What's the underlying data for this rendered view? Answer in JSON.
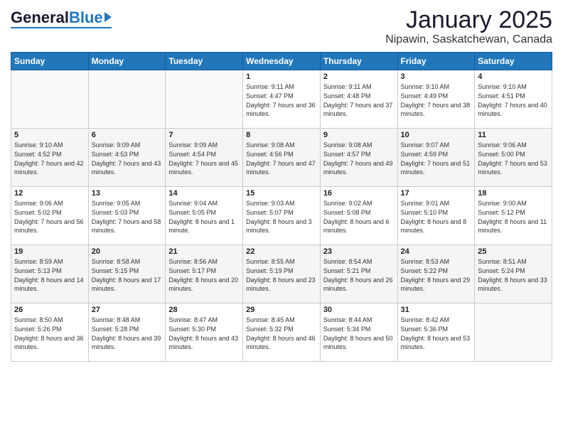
{
  "logo": {
    "general": "General",
    "blue": "Blue"
  },
  "header": {
    "month": "January 2025",
    "location": "Nipawin, Saskatchewan, Canada"
  },
  "weekdays": [
    "Sunday",
    "Monday",
    "Tuesday",
    "Wednesday",
    "Thursday",
    "Friday",
    "Saturday"
  ],
  "weeks": [
    [
      {
        "day": "",
        "info": ""
      },
      {
        "day": "",
        "info": ""
      },
      {
        "day": "",
        "info": ""
      },
      {
        "day": "1",
        "info": "Sunrise: 9:11 AM\nSunset: 4:47 PM\nDaylight: 7 hours and 36 minutes."
      },
      {
        "day": "2",
        "info": "Sunrise: 9:11 AM\nSunset: 4:48 PM\nDaylight: 7 hours and 37 minutes."
      },
      {
        "day": "3",
        "info": "Sunrise: 9:10 AM\nSunset: 4:49 PM\nDaylight: 7 hours and 38 minutes."
      },
      {
        "day": "4",
        "info": "Sunrise: 9:10 AM\nSunset: 4:51 PM\nDaylight: 7 hours and 40 minutes."
      }
    ],
    [
      {
        "day": "5",
        "info": "Sunrise: 9:10 AM\nSunset: 4:52 PM\nDaylight: 7 hours and 42 minutes."
      },
      {
        "day": "6",
        "info": "Sunrise: 9:09 AM\nSunset: 4:53 PM\nDaylight: 7 hours and 43 minutes."
      },
      {
        "day": "7",
        "info": "Sunrise: 9:09 AM\nSunset: 4:54 PM\nDaylight: 7 hours and 45 minutes."
      },
      {
        "day": "8",
        "info": "Sunrise: 9:08 AM\nSunset: 4:56 PM\nDaylight: 7 hours and 47 minutes."
      },
      {
        "day": "9",
        "info": "Sunrise: 9:08 AM\nSunset: 4:57 PM\nDaylight: 7 hours and 49 minutes."
      },
      {
        "day": "10",
        "info": "Sunrise: 9:07 AM\nSunset: 4:59 PM\nDaylight: 7 hours and 51 minutes."
      },
      {
        "day": "11",
        "info": "Sunrise: 9:06 AM\nSunset: 5:00 PM\nDaylight: 7 hours and 53 minutes."
      }
    ],
    [
      {
        "day": "12",
        "info": "Sunrise: 9:06 AM\nSunset: 5:02 PM\nDaylight: 7 hours and 56 minutes."
      },
      {
        "day": "13",
        "info": "Sunrise: 9:05 AM\nSunset: 5:03 PM\nDaylight: 7 hours and 58 minutes."
      },
      {
        "day": "14",
        "info": "Sunrise: 9:04 AM\nSunset: 5:05 PM\nDaylight: 8 hours and 1 minute."
      },
      {
        "day": "15",
        "info": "Sunrise: 9:03 AM\nSunset: 5:07 PM\nDaylight: 8 hours and 3 minutes."
      },
      {
        "day": "16",
        "info": "Sunrise: 9:02 AM\nSunset: 5:08 PM\nDaylight: 8 hours and 6 minutes."
      },
      {
        "day": "17",
        "info": "Sunrise: 9:01 AM\nSunset: 5:10 PM\nDaylight: 8 hours and 8 minutes."
      },
      {
        "day": "18",
        "info": "Sunrise: 9:00 AM\nSunset: 5:12 PM\nDaylight: 8 hours and 11 minutes."
      }
    ],
    [
      {
        "day": "19",
        "info": "Sunrise: 8:59 AM\nSunset: 5:13 PM\nDaylight: 8 hours and 14 minutes."
      },
      {
        "day": "20",
        "info": "Sunrise: 8:58 AM\nSunset: 5:15 PM\nDaylight: 8 hours and 17 minutes."
      },
      {
        "day": "21",
        "info": "Sunrise: 8:56 AM\nSunset: 5:17 PM\nDaylight: 8 hours and 20 minutes."
      },
      {
        "day": "22",
        "info": "Sunrise: 8:55 AM\nSunset: 5:19 PM\nDaylight: 8 hours and 23 minutes."
      },
      {
        "day": "23",
        "info": "Sunrise: 8:54 AM\nSunset: 5:21 PM\nDaylight: 8 hours and 26 minutes."
      },
      {
        "day": "24",
        "info": "Sunrise: 8:53 AM\nSunset: 5:22 PM\nDaylight: 8 hours and 29 minutes."
      },
      {
        "day": "25",
        "info": "Sunrise: 8:51 AM\nSunset: 5:24 PM\nDaylight: 8 hours and 33 minutes."
      }
    ],
    [
      {
        "day": "26",
        "info": "Sunrise: 8:50 AM\nSunset: 5:26 PM\nDaylight: 8 hours and 36 minutes."
      },
      {
        "day": "27",
        "info": "Sunrise: 8:48 AM\nSunset: 5:28 PM\nDaylight: 8 hours and 39 minutes."
      },
      {
        "day": "28",
        "info": "Sunrise: 8:47 AM\nSunset: 5:30 PM\nDaylight: 8 hours and 43 minutes."
      },
      {
        "day": "29",
        "info": "Sunrise: 8:45 AM\nSunset: 5:32 PM\nDaylight: 8 hours and 46 minutes."
      },
      {
        "day": "30",
        "info": "Sunrise: 8:44 AM\nSunset: 5:34 PM\nDaylight: 8 hours and 50 minutes."
      },
      {
        "day": "31",
        "info": "Sunrise: 8:42 AM\nSunset: 5:36 PM\nDaylight: 8 hours and 53 minutes."
      },
      {
        "day": "",
        "info": ""
      }
    ]
  ]
}
